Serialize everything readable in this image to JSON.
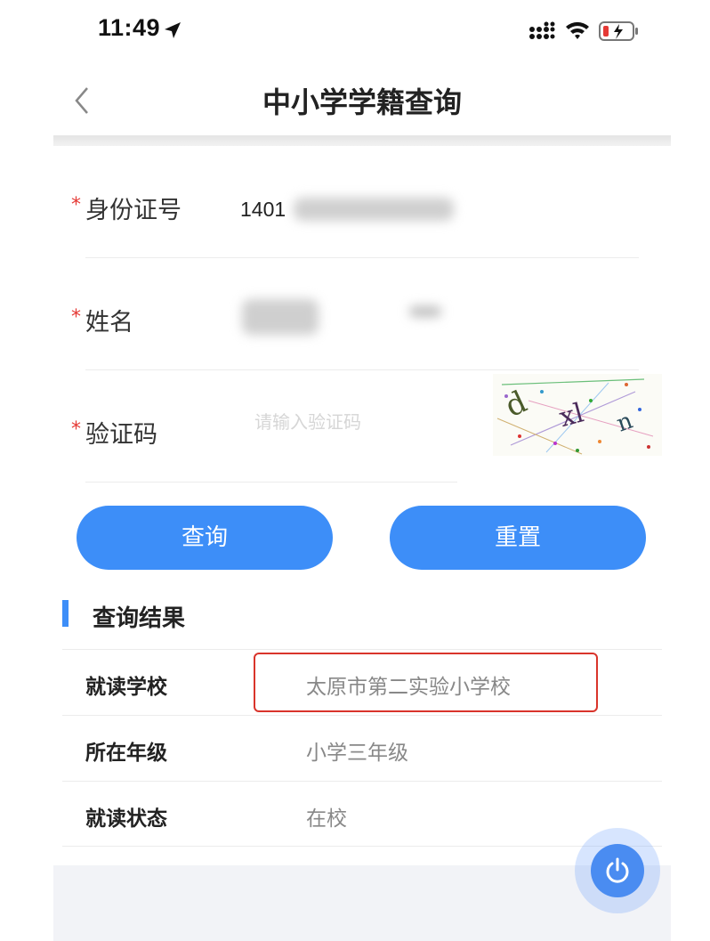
{
  "status_bar": {
    "time": "11:49"
  },
  "nav": {
    "title": "中小学学籍查询"
  },
  "form": {
    "required_mark": "*",
    "id_label": "身份证号",
    "id_value": "1401",
    "name_label": "姓名",
    "captcha_label": "验证码",
    "captcha_placeholder": "请输入验证码"
  },
  "buttons": {
    "query": "查询",
    "reset": "重置"
  },
  "results": {
    "section_title": "查询结果",
    "rows": [
      {
        "label": "就读学校",
        "value": "太原市第二实验小学校"
      },
      {
        "label": "所在年级",
        "value": "小学三年级"
      },
      {
        "label": "就读状态",
        "value": "在校"
      }
    ]
  },
  "colors": {
    "accent": "#3d8ef8",
    "required": "#e53935",
    "highlight": "#d9342b"
  }
}
